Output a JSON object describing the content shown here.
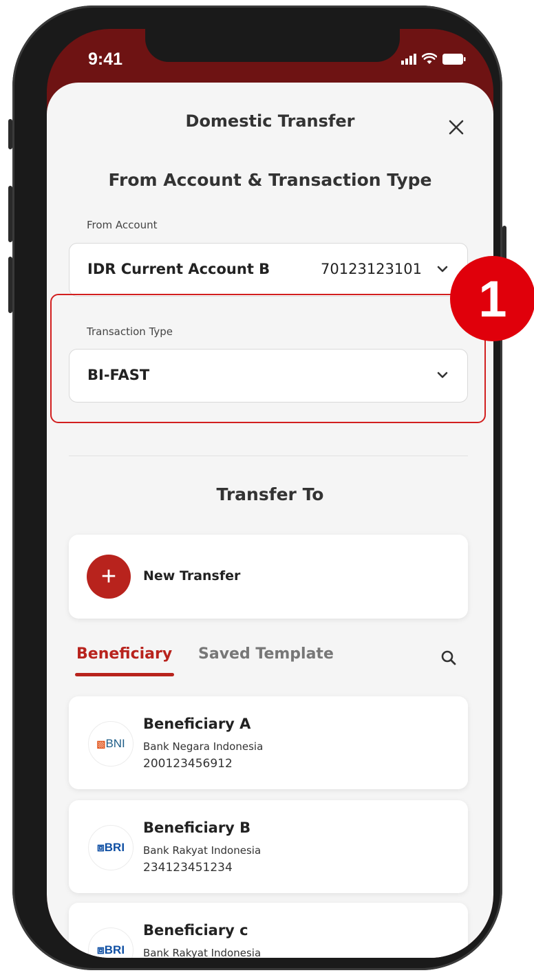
{
  "status_bar": {
    "time": "9:41",
    "signal_icon": "cellular-signal-icon",
    "wifi_icon": "wifi-icon",
    "battery_icon": "battery-icon"
  },
  "header": {
    "title": "Domestic Transfer",
    "close_icon": "close-icon"
  },
  "section_from": {
    "title": "From Account & Transaction Type"
  },
  "from_account": {
    "label": "From Account",
    "value": "IDR Current Account B",
    "account_number": "70123123101"
  },
  "transaction_type": {
    "label": "Transaction Type",
    "value": "BI-FAST"
  },
  "annotation": {
    "step_number": "1",
    "highlight_color": "#d21f1f"
  },
  "section_to": {
    "title": "Transfer To"
  },
  "new_transfer": {
    "label": "New Transfer",
    "icon": "plus-icon"
  },
  "tabs": [
    {
      "label": "Beneficiary",
      "active": true
    },
    {
      "label": "Saved Template",
      "active": false
    }
  ],
  "search_icon": "search-icon",
  "beneficiaries": [
    {
      "name": "Beneficiary A",
      "bank": "Bank Negara Indonesia",
      "account": "200123456912",
      "logo": "BNI"
    },
    {
      "name": "Beneficiary B",
      "bank": "Bank Rakyat Indonesia",
      "account": "234123451234",
      "logo": "BRI"
    },
    {
      "name": "Beneficiary c",
      "bank": "Bank Rakyat Indonesia",
      "account": "",
      "logo": "BRI"
    }
  ],
  "colors": {
    "brand": "#b8231d",
    "header_bg": "#6e1313",
    "sheet_bg": "#f5f5f5",
    "badge": "#e0000b"
  }
}
